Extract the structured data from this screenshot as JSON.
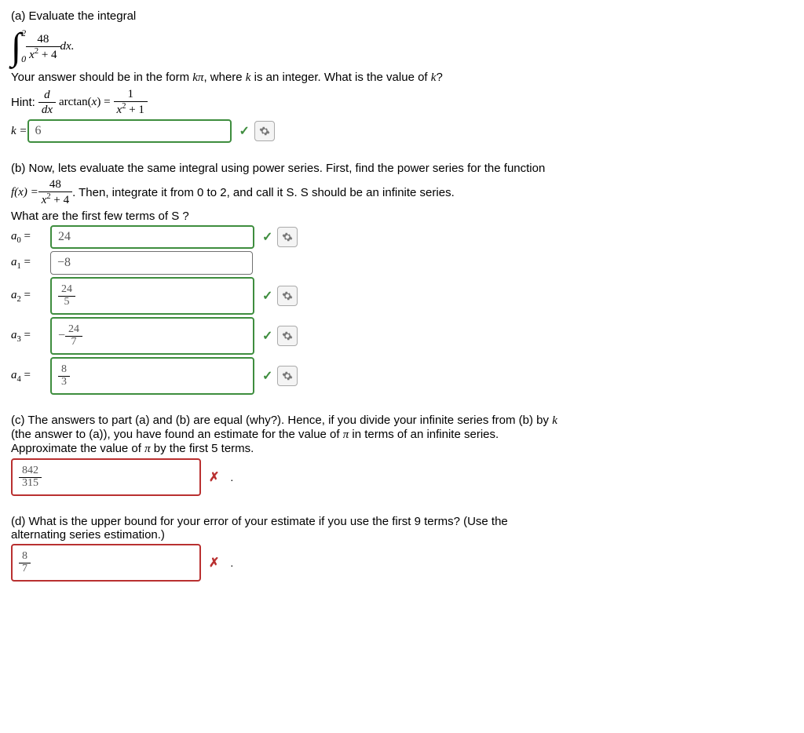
{
  "a": {
    "heading": "(a) Evaluate the integral",
    "int_upper": "2",
    "int_lower": "0",
    "frac_num": "48",
    "frac_den_pre": "x",
    "frac_den_exp": "2",
    "frac_den_post": " + 4",
    "dx": " dx.",
    "line2_pre": "Your answer should be in the form ",
    "line2_kpi": "kπ",
    "line2_mid": ", where ",
    "line2_k": "k",
    "line2_post": " is an integer. What is the value of ",
    "line2_k2": "k",
    "line2_q": "?",
    "hint_label": "Hint: ",
    "hint_num": "d",
    "hint_den": "dx",
    "hint_arctan": "arctan(",
    "hint_x": "x",
    "hint_close": ") = ",
    "hint_r_num": "1",
    "hint_r_den_pre": "x",
    "hint_r_den_exp": "2",
    "hint_r_den_post": " + 1",
    "k_label": "k = ",
    "k_value": "6"
  },
  "b": {
    "line1": "(b) Now, lets evaluate the same integral using power series. First, find the power series for the function",
    "fx": "f(x) = ",
    "frac_num": "48",
    "frac_den_pre": "x",
    "frac_den_exp": "2",
    "frac_den_post": " + 4",
    "line2": ". Then, integrate it from 0 to 2, and call it S. S should be an infinite series.",
    "line3": "What are the first few terms of S ?",
    "a0_label": "a",
    "a0_sub": "0",
    "eq": " = ",
    "a0_val": "24",
    "a1_sub": "1",
    "a1_val": "−8",
    "a2_sub": "2",
    "a2_num": "24",
    "a2_den": "5",
    "a3_sub": "3",
    "a3_neg": "− ",
    "a3_num": "24",
    "a3_den": "7",
    "a4_sub": "4",
    "a4_num": "8",
    "a4_den": "3"
  },
  "c": {
    "line1": "(c) The answers to part (a) and (b) are equal (why?). Hence, if you divide your infinite series from (b) by ",
    "k": "k",
    "line2": "(the answer to (a)), you have found an estimate for the value of ",
    "pi": "π",
    "line2b": " in terms of an infinite series.",
    "line3_pre": "Approximate the value of ",
    "line3_post": " by the first 5 terms.",
    "ans_num": "842",
    "ans_den": "315",
    "dot": "."
  },
  "d": {
    "line1": "(d) What is the upper bound for your error of your estimate if you use the first 9 terms? (Use the",
    "line2": "alternating series estimation.)",
    "ans_num": "8",
    "ans_den": "7",
    "dot": "."
  }
}
